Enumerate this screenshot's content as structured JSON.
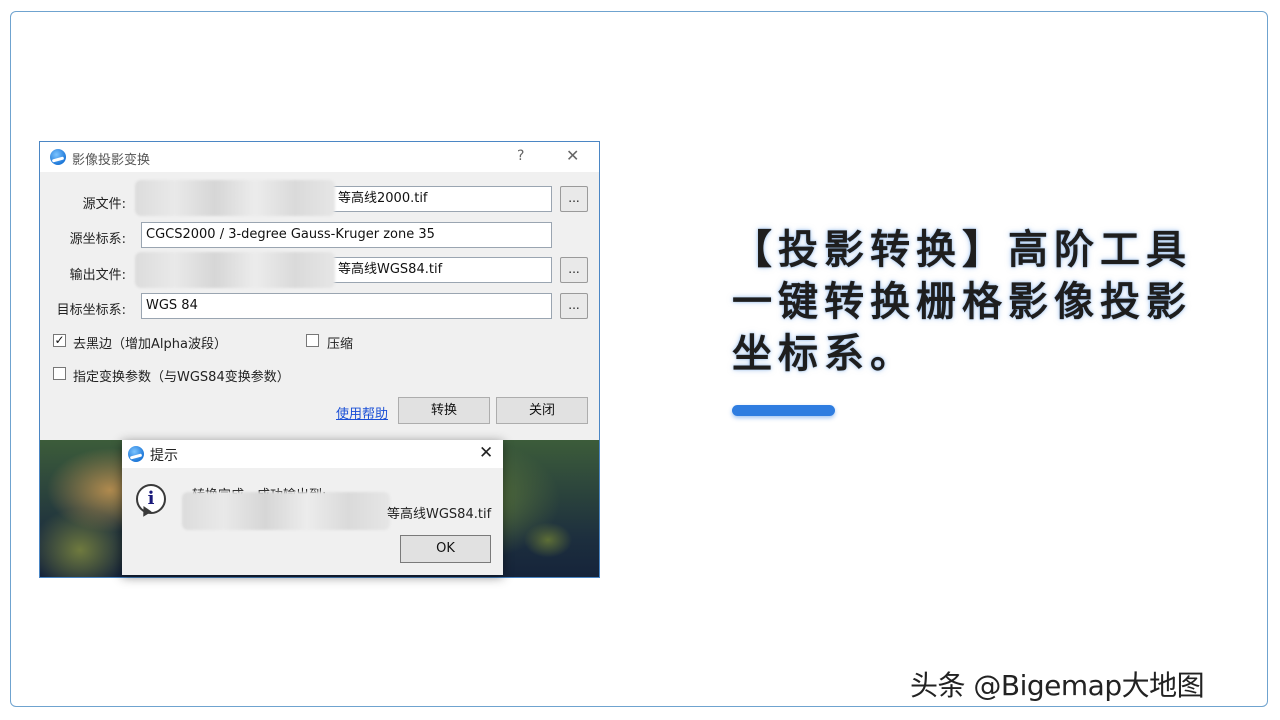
{
  "dialog": {
    "title": "影像投影变换",
    "help_button": "?",
    "close_button": "✕",
    "source_file_label": "源文件:",
    "source_file_value": "等高线2000.tif",
    "source_crs_label": "源坐标系:",
    "source_crs_value": "CGCS2000 / 3-degree Gauss-Kruger zone 35",
    "output_file_label": "输出文件:",
    "output_file_value": "等高线WGS84.tif",
    "target_crs_label": "目标坐标系:",
    "target_crs_value": "WGS 84",
    "browse_label": "...",
    "remove_black_edge_label": "去黑边（增加Alpha波段）",
    "remove_black_edge_checked": true,
    "compress_label": "压缩",
    "compress_checked": false,
    "specify_params_label": "指定变换参数（与WGS84变换参数）",
    "specify_params_checked": false,
    "help_link": "使用帮助",
    "convert_button": "转换",
    "close_dialog_button": "关闭"
  },
  "popup": {
    "title": "提示",
    "close_button": "✕",
    "message_line1": "转换完成，成功输出到:",
    "message_path_suffix": "等高线WGS84.tif",
    "ok_button": "OK"
  },
  "slide": {
    "headline": "【投影转换】高阶工具一键转换栅格影像投影坐标系。",
    "accent_color": "#2f7de0"
  },
  "watermark": "头条 @Bigemap大地图",
  "icons": {
    "app_logo": "bigemap-logo-icon",
    "info": "info-icon",
    "check": "check-icon"
  }
}
